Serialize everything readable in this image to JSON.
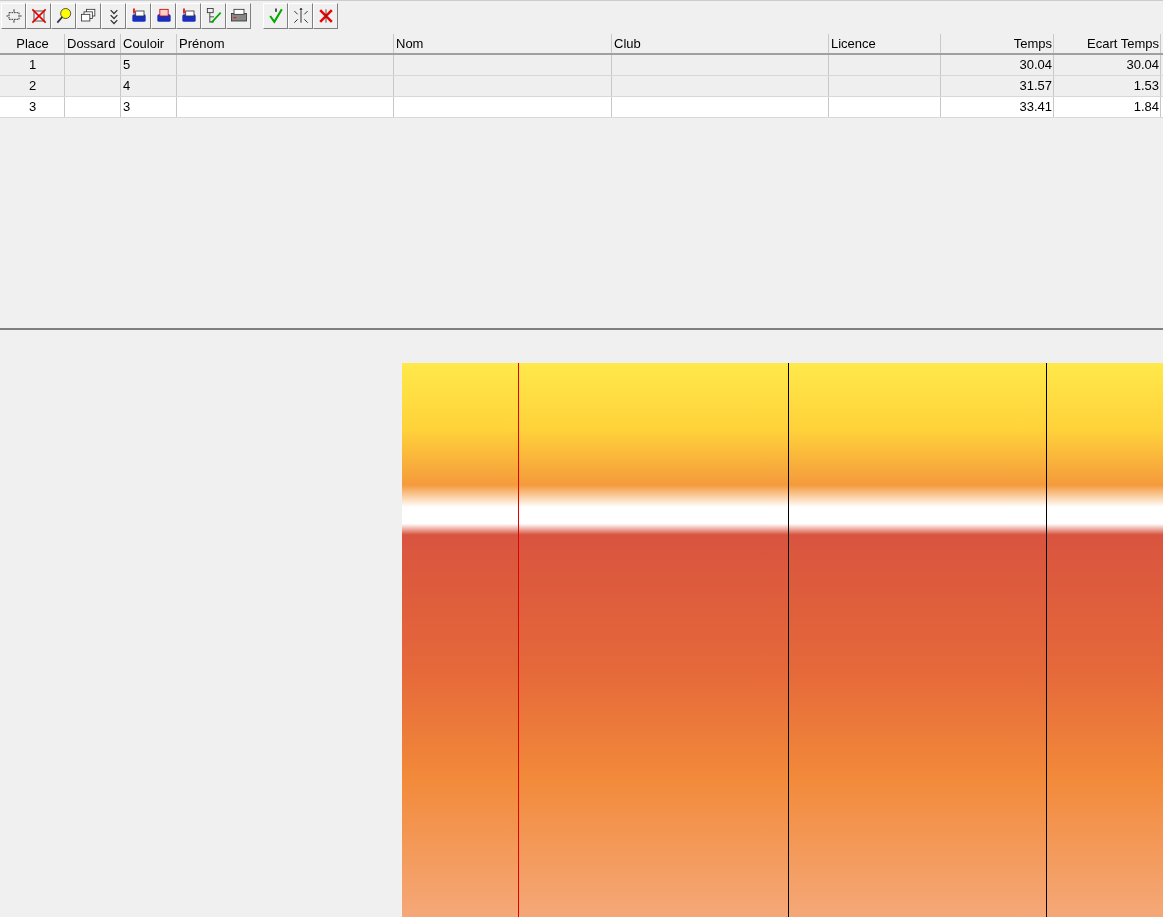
{
  "table": {
    "columns": [
      "Place",
      "Dossard",
      "Couloir",
      "Prénom",
      "Nom",
      "Club",
      "Licence",
      "Temps",
      "Ecart Temps"
    ],
    "rows": [
      {
        "selected": false,
        "cells": [
          "1",
          "",
          "5",
          "",
          "",
          "",
          "",
          "30.04",
          "30.04"
        ]
      },
      {
        "selected": false,
        "cells": [
          "2",
          "",
          "4",
          "",
          "",
          "",
          "",
          "31.57",
          "1.53"
        ]
      },
      {
        "selected": true,
        "cells": [
          "3",
          "",
          "3",
          "",
          "",
          "",
          "",
          "33.41",
          "1.84"
        ]
      }
    ]
  }
}
